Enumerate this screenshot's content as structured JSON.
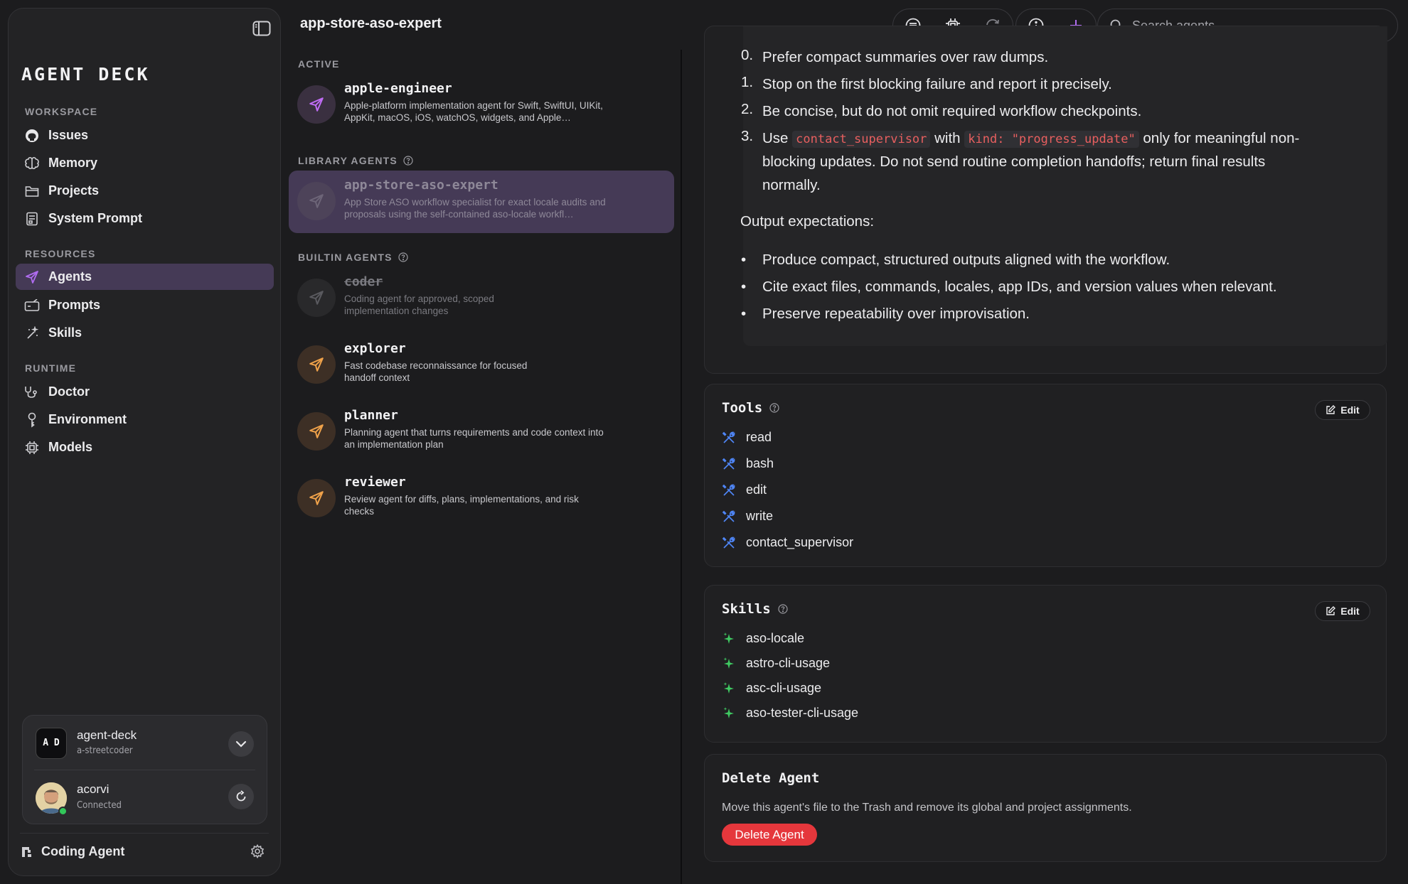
{
  "sidebar": {
    "logo": "AGENT DECK",
    "sections": {
      "workspace": "WORKSPACE",
      "resources": "RESOURCES",
      "runtime": "RUNTIME"
    },
    "items": {
      "issues": "Issues",
      "memory": "Memory",
      "projects": "Projects",
      "system_prompt": "System Prompt",
      "agents": "Agents",
      "prompts": "Prompts",
      "skills": "Skills",
      "doctor": "Doctor",
      "environment": "Environment",
      "models": "Models"
    },
    "workspace_account": {
      "name": "agent-deck",
      "sub": "a-streetcoder",
      "logo_text": "A D"
    },
    "user_account": {
      "name": "acorvi",
      "status": "Connected"
    },
    "footer": "Coding Agent"
  },
  "topbar": {
    "title": "app-store-aso-expert",
    "search_placeholder": "Search agents"
  },
  "agent_list": {
    "active_label": "ACTIVE",
    "library_label": "LIBRARY AGENTS",
    "builtin_label": "BUILTIN AGENTS",
    "active": [
      {
        "name": "apple-engineer",
        "desc": "Apple-platform implementation agent for Swift, SwiftUI, UIKit, AppKit, macOS, iOS, watchOS, widgets, and Apple…"
      }
    ],
    "library": [
      {
        "name": "app-store-aso-expert",
        "desc": "App Store ASO workflow specialist for exact locale audits and proposals using the self-contained aso-locale workfl…"
      }
    ],
    "builtin": [
      {
        "name": "coder",
        "desc": "Coding agent for approved, scoped implementation changes"
      },
      {
        "name": "explorer",
        "desc": "Fast codebase reconnaissance for focused handoff context"
      },
      {
        "name": "planner",
        "desc": "Planning agent that turns requirements and code context into an implementation plan"
      },
      {
        "name": "reviewer",
        "desc": "Review agent for diffs, plans, implementations, and risk checks"
      }
    ]
  },
  "prompt": {
    "list": [
      {
        "num": "0.",
        "text": "Prefer compact summaries over raw dumps."
      },
      {
        "num": "1.",
        "text": "Stop on the first blocking failure and report it precisely."
      },
      {
        "num": "2.",
        "text": "Be concise, but do not omit required workflow checkpoints."
      }
    ],
    "item3": {
      "num": "3.",
      "use": "Use",
      "code1": "contact_supervisor",
      "with": "with",
      "code2": "kind: \"progress_update\"",
      "rest1": "only for meaningful non-",
      "rest2": "blocking updates. Do not send routine completion handoffs; return final results",
      "rest3": "normally."
    },
    "output_heading": "Output expectations:",
    "bullets": [
      "Produce compact, structured outputs aligned with the workflow.",
      "Cite exact files, commands, locales, app IDs, and version values when relevant.",
      "Preserve repeatability over improvisation."
    ]
  },
  "tools": {
    "title": "Tools",
    "edit": "Edit",
    "items": [
      "read",
      "bash",
      "edit",
      "write",
      "contact_supervisor"
    ]
  },
  "skills": {
    "title": "Skills",
    "edit": "Edit",
    "items": [
      "aso-locale",
      "astro-cli-usage",
      "asc-cli-usage",
      "aso-tester-cli-usage"
    ]
  },
  "delete": {
    "title": "Delete Agent",
    "desc": "Move this agent's file to the Trash and remove its global and project assignments.",
    "button": "Delete Agent"
  },
  "colors": {
    "accent": "#b06cf0",
    "selected": "#453a56",
    "orange": "#f0a24a",
    "danger": "#e5373c",
    "tool_blue": "#4f86f7",
    "skill_green": "#3fca62"
  }
}
